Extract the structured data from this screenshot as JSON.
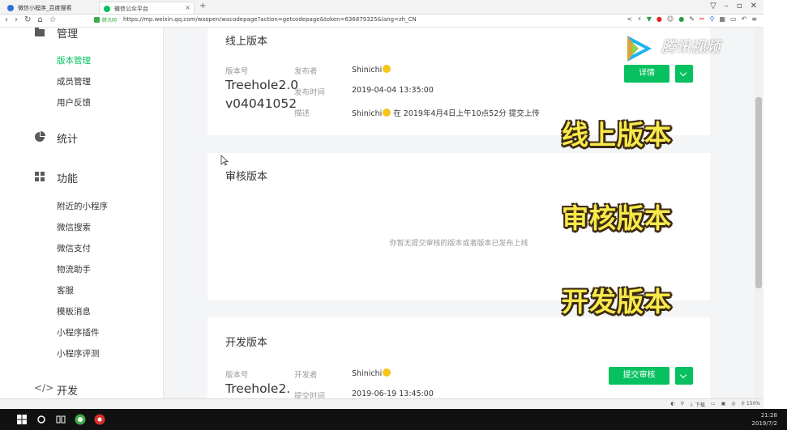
{
  "browser": {
    "tabs": [
      {
        "label": "微信小程序_百度搜索",
        "icon_color": "#2f6fdc"
      },
      {
        "label": "微信公众平台",
        "icon_color": "#07c160"
      }
    ],
    "new_tab": "+",
    "window_controls": [
      "▽",
      "–",
      "▫",
      "✕"
    ],
    "url": "https://mp.weixin.qq.com/wxopen/wacodepage?action=getcodepage&token=636879325&lang=zh_CN",
    "secure_label": "腾讯网"
  },
  "sidebar": {
    "cut_top_label": "管理",
    "manage_items": [
      {
        "label": "版本管理",
        "active": true
      },
      {
        "label": "成员管理",
        "active": false
      },
      {
        "label": "用户反馈",
        "active": false
      }
    ],
    "stats_label": "统计",
    "features_label": "功能",
    "feature_items": [
      "附近的小程序",
      "微信搜索",
      "微信支付",
      "物流助手",
      "客服",
      "模板消息",
      "小程序插件",
      "小程序评测"
    ],
    "dev_label": "开发"
  },
  "online": {
    "title": "线上版本",
    "label_version": "版本号",
    "version": "Treehole2.0v04041052",
    "label_publisher": "发布者",
    "publisher": "Shinichi",
    "label_time": "发布时间",
    "time": "2019-04-04 13:35:00",
    "label_desc": "描述",
    "desc_user": "Shinichi",
    "desc_text": "在 2019年4月4日上午10点52分 提交上传",
    "detail_button": "详情"
  },
  "review": {
    "title": "审核版本",
    "empty_tip": "你暂无提交审核的版本或者版本已发布上线"
  },
  "develop": {
    "title": "开发版本",
    "label_version": "版本号",
    "version": "Treehole2.",
    "label_developer": "开发者",
    "developer": "Shinichi",
    "label_time": "提交时间",
    "time": "2019-06-19 13:45:00",
    "submit_button": "提交审核"
  },
  "captions": [
    "线上版本",
    "审核版本",
    "开发版本"
  ],
  "watermark": "腾讯视频",
  "status": {
    "zoom": "150%",
    "download": "下载"
  },
  "taskbar": {
    "time": "21:28",
    "date": "2019/7/2"
  },
  "colors": {
    "accent": "#07c160",
    "caption": "#f7e94a"
  }
}
